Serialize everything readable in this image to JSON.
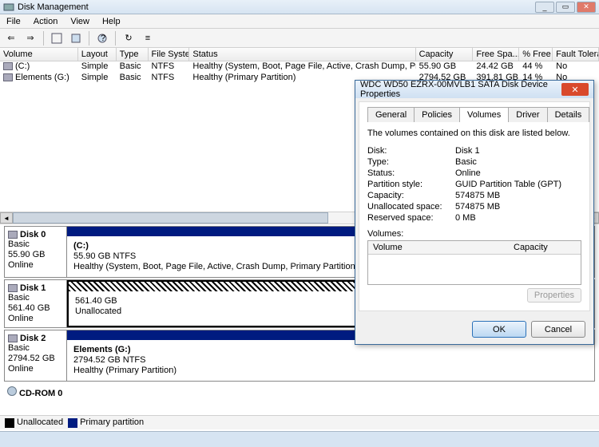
{
  "window": {
    "title": "Disk Management"
  },
  "menu": [
    "File",
    "Action",
    "View",
    "Help"
  ],
  "columns": {
    "volume": "Volume",
    "layout": "Layout",
    "type": "Type",
    "fs": "File System",
    "status": "Status",
    "capacity": "Capacity",
    "free": "Free Spa...",
    "pct": "% Free",
    "ft": "Fault Tolerance"
  },
  "volumes": [
    {
      "name": "(C:)",
      "layout": "Simple",
      "type": "Basic",
      "fs": "NTFS",
      "status": "Healthy (System, Boot, Page File, Active, Crash Dump, Primary Partition)",
      "capacity": "55.90 GB",
      "free": "24.42 GB",
      "pct": "44 %",
      "ft": "No"
    },
    {
      "name": "Elements (G:)",
      "layout": "Simple",
      "type": "Basic",
      "fs": "NTFS",
      "status": "Healthy (Primary Partition)",
      "capacity": "2794.52 GB",
      "free": "391.81 GB",
      "pct": "14 %",
      "ft": "No"
    }
  ],
  "disks": [
    {
      "name": "Disk 0",
      "type": "Basic",
      "size": "55.90 GB",
      "state": "Online",
      "vol": {
        "title": "(C:)",
        "sub": "55.90 GB NTFS",
        "health": "Healthy (System, Boot, Page File, Active, Crash Dump, Primary Partition)"
      },
      "bar": "blue"
    },
    {
      "name": "Disk 1",
      "type": "Basic",
      "size": "561.40 GB",
      "state": "Online",
      "vol": {
        "title": "",
        "sub": "561.40 GB",
        "health": "Unallocated"
      },
      "bar": "hatch"
    },
    {
      "name": "Disk 2",
      "type": "Basic",
      "size": "2794.52 GB",
      "state": "Online",
      "vol": {
        "title": "Elements  (G:)",
        "sub": "2794.52 GB NTFS",
        "health": "Healthy (Primary Partition)"
      },
      "bar": "blue"
    },
    {
      "name": "CD-ROM 0",
      "type": "",
      "size": "",
      "state": "",
      "vol": null,
      "bar": ""
    }
  ],
  "legend": {
    "unalloc": "Unallocated",
    "primary": "Primary partition"
  },
  "dialog": {
    "title": "WDC WD50 EZRX-00MVLB1 SATA Disk Device Properties",
    "tabs": [
      "General",
      "Policies",
      "Volumes",
      "Driver",
      "Details"
    ],
    "activeTab": 2,
    "intro": "The volumes contained on this disk are listed below.",
    "props": [
      {
        "k": "Disk:",
        "v": "Disk 1"
      },
      {
        "k": "Type:",
        "v": "Basic"
      },
      {
        "k": "Status:",
        "v": "Online"
      },
      {
        "k": "Partition style:",
        "v": "GUID Partition Table (GPT)"
      },
      {
        "k": "Capacity:",
        "v": "574875 MB"
      },
      {
        "k": "Unallocated space:",
        "v": "574875 MB"
      },
      {
        "k": "Reserved space:",
        "v": "0 MB"
      }
    ],
    "volLabel": "Volumes:",
    "volCols": {
      "a": "Volume",
      "b": "Capacity"
    },
    "propBtn": "Properties",
    "ok": "OK",
    "cancel": "Cancel"
  }
}
